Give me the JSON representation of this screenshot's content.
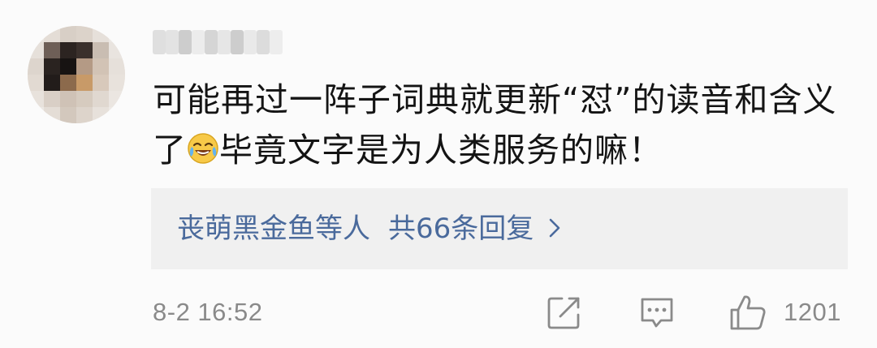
{
  "comment": {
    "text_part1": "可能再过一阵子词典就更新“怼”的读音和含义了",
    "emoji": "laugh-cry-emoji",
    "text_part2": "毕竟文字是为人类服务的嘛！",
    "replies": {
      "names": "丧萌黑金鱼等人",
      "count_label": "共66条回复"
    },
    "timestamp": "8-2 16:52",
    "like_count": "1201"
  },
  "colors": {
    "background": "#fbfbfb",
    "text": "#141414",
    "link": "#4a6a9c",
    "meta": "#8a8a8a",
    "reply_box": "#f0f0f0"
  }
}
